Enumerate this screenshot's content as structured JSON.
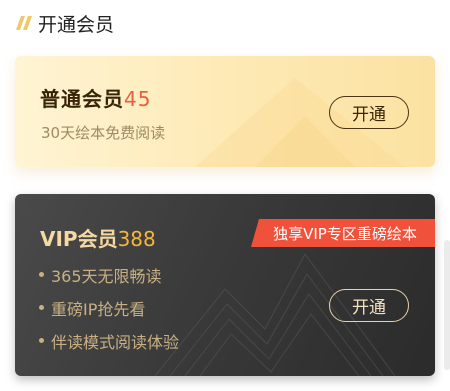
{
  "section": {
    "title": "开通会员"
  },
  "normal_card": {
    "name": "普通会员",
    "price": "45",
    "subtitle": "30天绘本免费阅读",
    "button_label": "开通"
  },
  "vip_card": {
    "name": "VIP会员",
    "price": "388",
    "badge": "独享VIP专区重磅绘本",
    "features": [
      "365天无限畅读",
      "重磅IP抢先看",
      "伴读模式阅读体验"
    ],
    "button_label": "开通"
  },
  "colors": {
    "price_normal": "#e8603c",
    "price_vip": "#f6b63a",
    "badge_bg": "#f0513a",
    "title_mark": "#f0c86b"
  },
  "icons": {
    "title_mark": "double-slash-icon"
  }
}
